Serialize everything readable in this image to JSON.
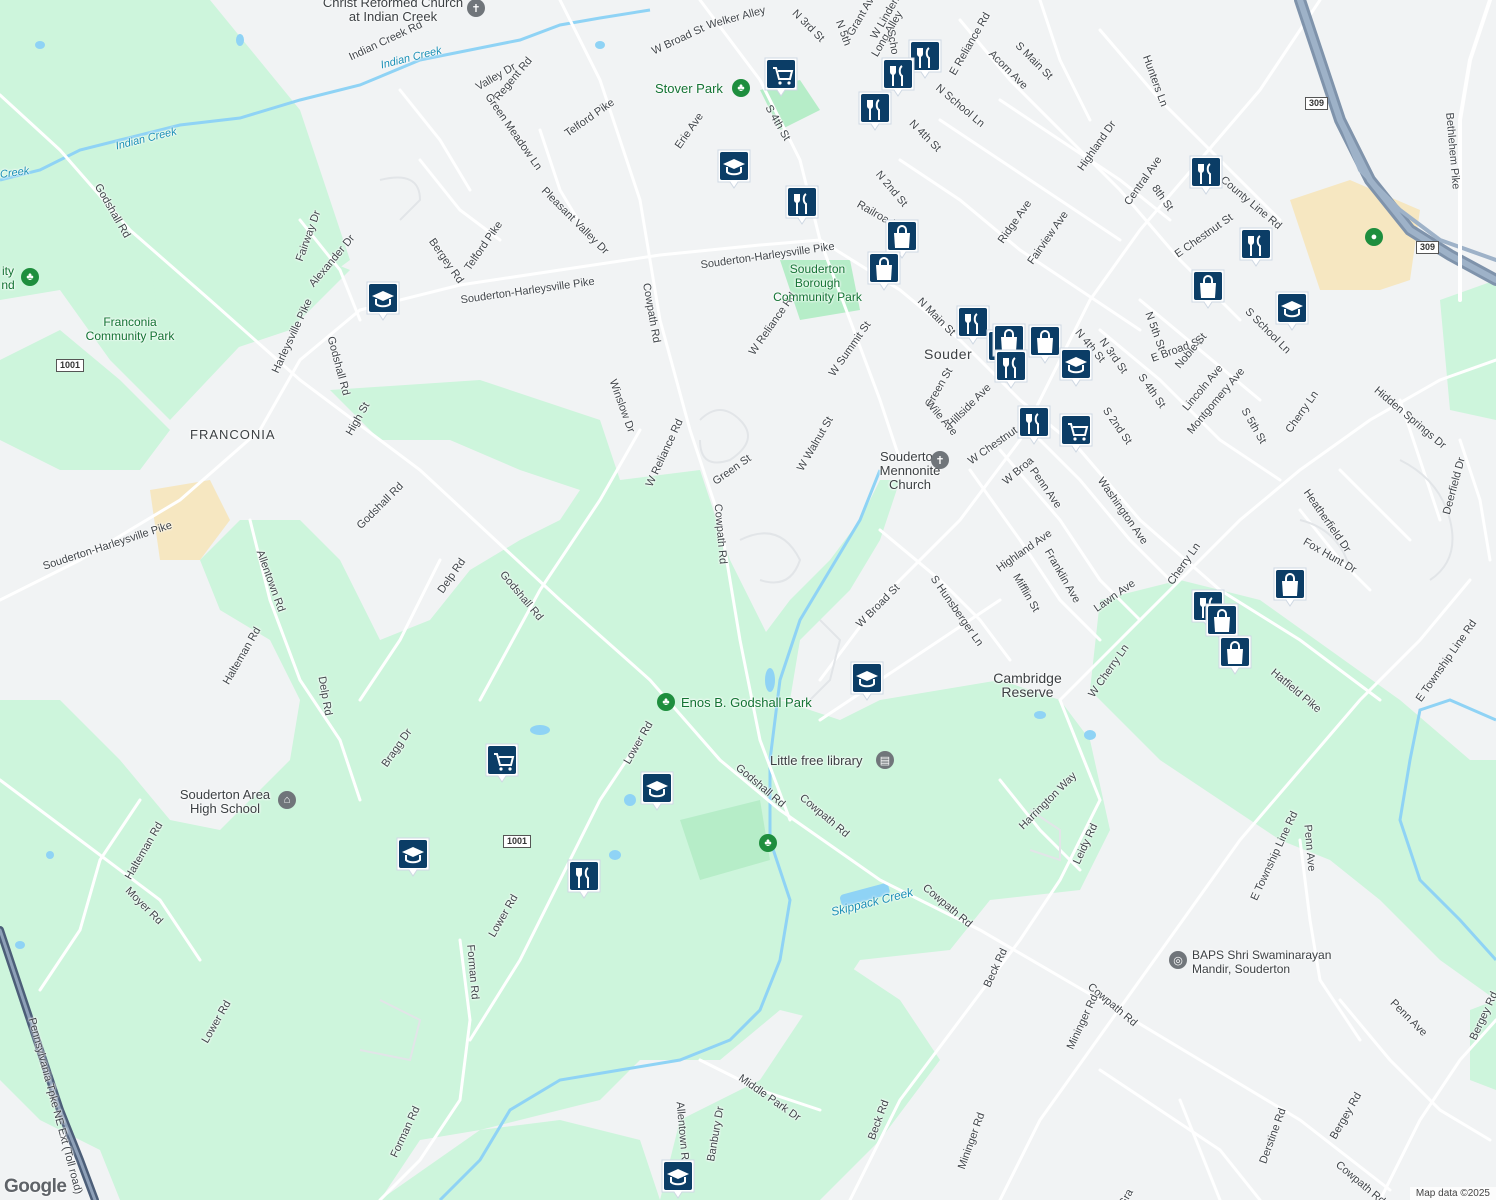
{
  "map": {
    "attribution": "Map data ©2025",
    "logo": "Google",
    "colors": {
      "land": "#f1f3f4",
      "park": "#cdf5dc",
      "water": "#8fd3f5",
      "road": "#ffffff",
      "highway": "#8a9db5",
      "pin": "#0b3d66",
      "urban": "#f6e7c1"
    },
    "roads": [
      "Indian Creek Rd",
      "Welker Alley",
      "W Broad St",
      "N 3rd St",
      "Grant Ave",
      "W Linden",
      "Long Alley",
      "Acorn Ave",
      "E Reliance Rd",
      "S Main St",
      "Hunters Ln",
      "Valley Dr",
      "Regent Rd",
      "Green Meadow Ln",
      "Telford Pike",
      "Erie Ave",
      "S 4th St",
      "N 5th",
      "Scho",
      "N School Ln",
      "N 4th St",
      "Highland Dr",
      "Central Ave",
      "8th St",
      "N 2nd St",
      "Railroad",
      "Ridge Ave",
      "Fairview Ave",
      "E Chestnut St",
      "County Line Rd",
      "Godshall Rd",
      "Pleasant Valley Dr",
      "Fairway Dr",
      "Alexander Dr",
      "Bergey Rd",
      "Telford Pike",
      "Souderton-Harleysville Pike",
      "Souderton-Harleysville Pike",
      "W Reliance Rd",
      "N Main St",
      "Cowpath Rd",
      "W Summit St",
      "Harleysville Pike",
      "Godshall Rd",
      "High St",
      "Winslow Dr",
      "W Reliance Rd",
      "Green St",
      "W Walnut St",
      "Green St",
      "Wile Ave",
      "Hillside Ave",
      "W Chestnut St",
      "N 4th St",
      "N 3rd St",
      "N 5th St",
      "E Broad St",
      "Noble St",
      "S 4th St",
      "S 2nd St",
      "Lincoln Ave",
      "Montgomery Ave",
      "S 5th St",
      "S School Ln",
      "Cherry Ln",
      "Hidden Springs Dr",
      "Bethlehem Pike",
      "Godshall Rd",
      "Souderton-Harleysville Pike",
      "Cowpath Rd",
      "W Broa",
      "Penn Ave",
      "Washington Ave",
      "Highland Ave",
      "Franklin Ave",
      "Mifflin St",
      "S Hunsberger Ln",
      "W Broad St",
      "Lawn Ave",
      "Cherry Ln",
      "Heatherfield Dr",
      "Fox Hunt Dr",
      "Deerfield Dr",
      "Allentown Rd",
      "Delp Rd",
      "Godshall Rd",
      "Halteman Rd",
      "Delp Rd",
      "Bragg Dr",
      "Lower Rd",
      "W Cherry Ln",
      "Hatfield Pike",
      "E Township Line Rd",
      "Harrington Way",
      "Leidy Rd",
      "Godshall Rd",
      "Cowpath Rd",
      "Halteman Rd",
      "Moyer Rd",
      "Lower Rd",
      "Forman Rd",
      "Cowpath Rd",
      "Beck Rd",
      "E Township Line Rd",
      "Penn Ave",
      "Cowpath Rd",
      "Lower Rd",
      "Forman Rd",
      "Allentown Rd",
      "Banbury Dr",
      "Middle Park Dr",
      "Beck Rd",
      "Mininger Rd",
      "Mininger Rd",
      "Penn Ave",
      "Bergey Rd",
      "Derstine Rd",
      "Bergey Rd",
      "Cowpath Rd",
      "Pennsylvania Tpke NE Ext (Toll road)",
      "Gra"
    ],
    "places": [
      "Christ Reformed Church at Indian Creek",
      "Stover Park",
      "Souderton Borough Community Park",
      "Franconia Community Park",
      "FRANCONIA",
      "Souder",
      "Souderton Mennonite Church",
      "Enos B. Godshall Park",
      "Cambridge Reserve",
      "Little free library",
      "Souderton Area High School",
      "BAPS Shri Swaminarayan Mandir, Souderton",
      "ity nd"
    ],
    "water": [
      "Indian Creek",
      "Indian Creek",
      "Creek",
      "Skippack Creek"
    ],
    "shields": [
      "1001",
      "1001",
      "309",
      "309"
    ],
    "pins": [
      "shopping-cart-icon",
      "restaurant-icon",
      "school-icon",
      "shopping-bag-icon"
    ]
  }
}
